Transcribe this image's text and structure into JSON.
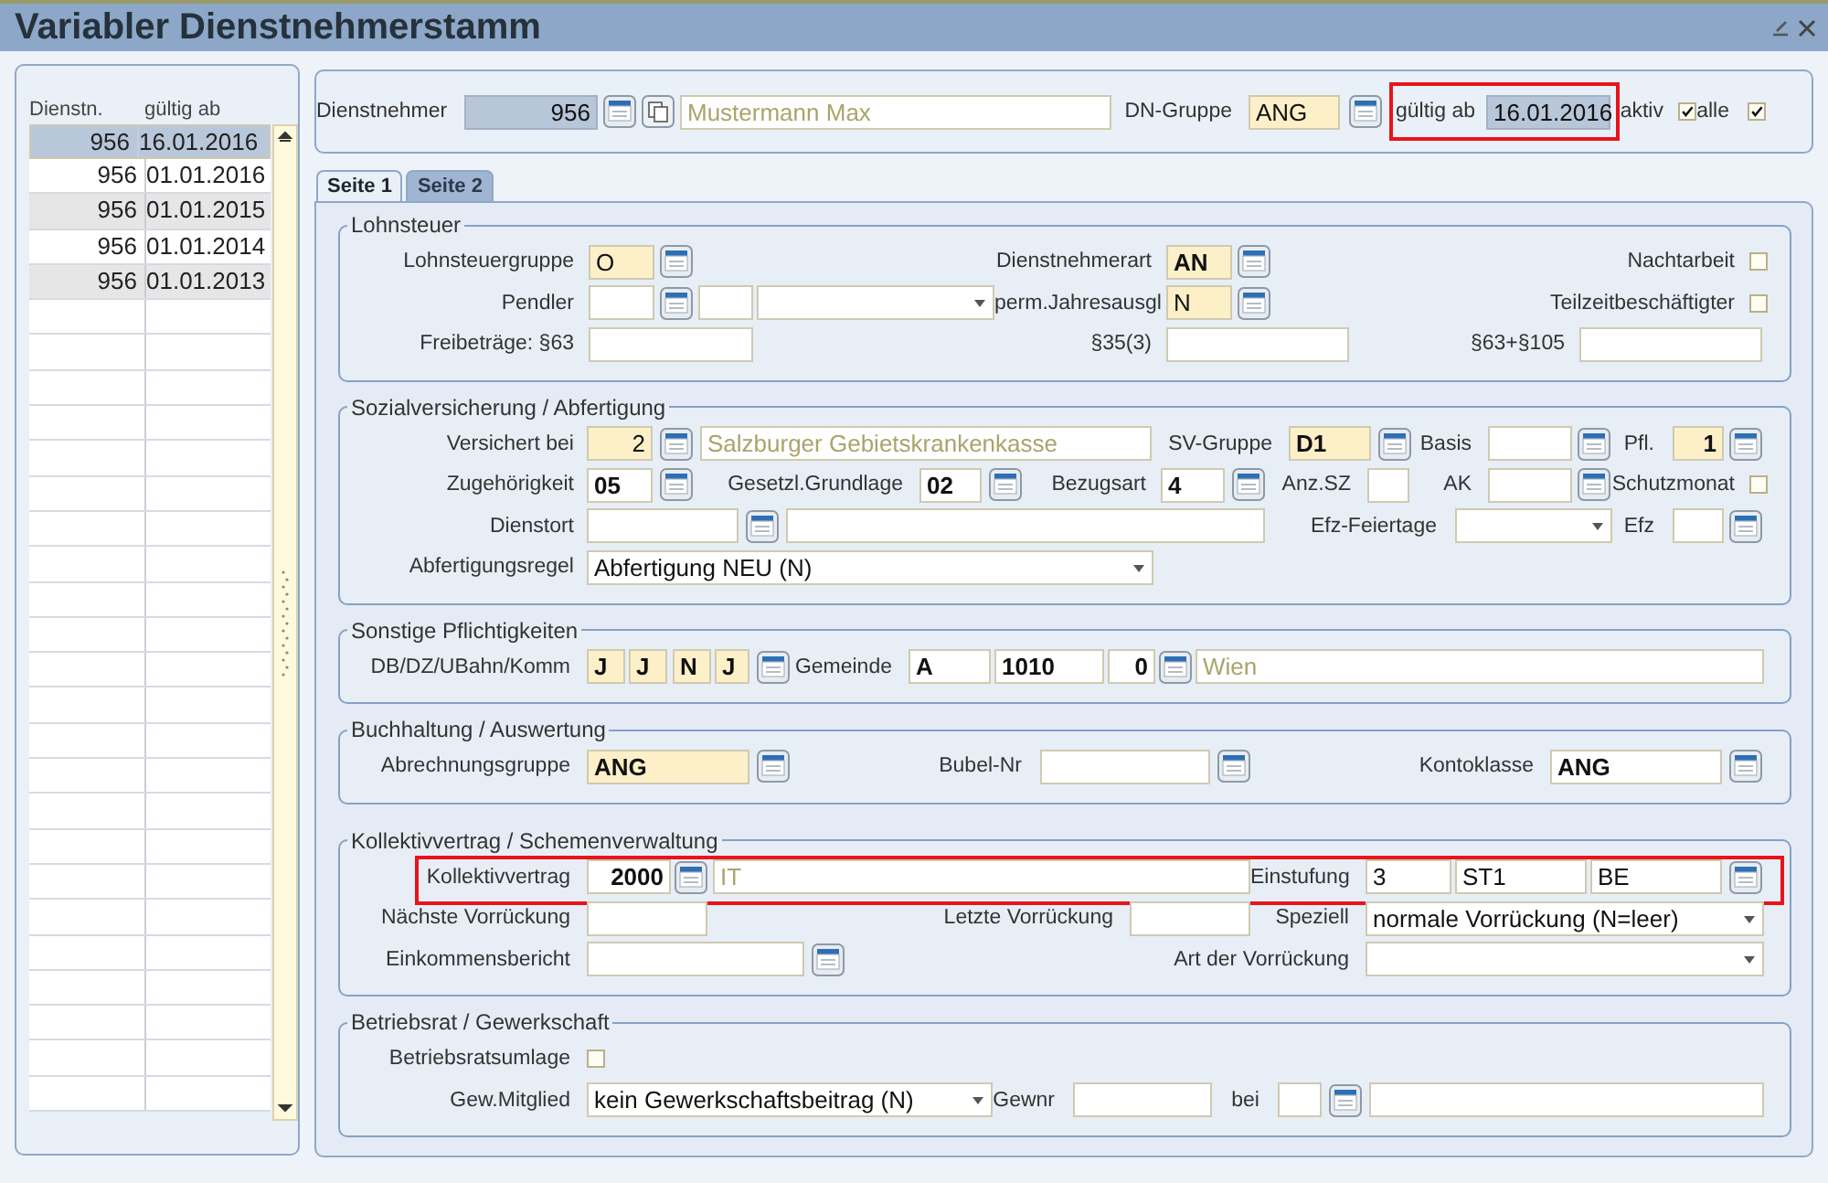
{
  "window": {
    "title": "Variabler Dienstnehmerstamm"
  },
  "list": {
    "columns": [
      "Dienstn.",
      "gültig ab"
    ],
    "rows": [
      {
        "cells": [
          "956",
          "16.01.2016"
        ],
        "selected": true
      },
      {
        "cells": [
          "956",
          "01.01.2016"
        ],
        "selected": false
      },
      {
        "cells": [
          "956",
          "01.01.2015"
        ],
        "selected": false
      },
      {
        "cells": [
          "956",
          "01.01.2014"
        ],
        "selected": false
      },
      {
        "cells": [
          "956",
          "01.01.2013"
        ],
        "selected": false
      }
    ]
  },
  "header": {
    "rows": [
      {
        "marked": true,
        "items": [
          {
            "kind": "label",
            "text": "Dienstnehmer"
          },
          {
            "kind": "readonly",
            "value": "956"
          },
          {
            "kind": "lookup"
          },
          {
            "kind": "copy"
          },
          {
            "kind": "display",
            "value": "Mustermann Max"
          },
          {
            "kind": "label",
            "text": "DN-Gruppe"
          },
          {
            "kind": "field",
            "value": "ANG",
            "highlighted": true,
            "bold": false
          },
          {
            "kind": "lookup"
          },
          {
            "kind": "label",
            "text": "gültig ab"
          },
          {
            "kind": "readonly",
            "value": "16.01.2016"
          },
          {
            "kind": "label",
            "text": "aktiv"
          },
          {
            "kind": "checkbox",
            "checked": true
          },
          {
            "kind": "label",
            "text": "alle"
          },
          {
            "kind": "checkbox",
            "checked": true
          }
        ]
      }
    ]
  },
  "tabs": [
    {
      "label": "Seite 1",
      "selected": true
    },
    {
      "label": "Seite 2",
      "selected": false
    }
  ],
  "sections": [
    {
      "title": "Lohnsteuer",
      "rows": [
        {
          "marked": false,
          "items": [
            {
              "kind": "label",
              "text": "Lohnsteuergruppe"
            },
            {
              "kind": "field",
              "value": "O",
              "highlighted": true,
              "bold": false
            },
            {
              "kind": "lookup"
            },
            {
              "kind": "label",
              "text": "Dienstnehmerart"
            },
            {
              "kind": "field",
              "value": "AN",
              "highlighted": true,
              "bold": true
            },
            {
              "kind": "lookup"
            },
            {
              "kind": "label",
              "text": "Nachtarbeit"
            },
            {
              "kind": "checkbox",
              "checked": false
            }
          ]
        },
        {
          "marked": false,
          "items": [
            {
              "kind": "label",
              "text": "Pendler"
            },
            {
              "kind": "field",
              "highlighted": false
            },
            {
              "kind": "lookup"
            },
            {
              "kind": "field",
              "highlighted": false
            },
            {
              "kind": "select"
            },
            {
              "kind": "label",
              "text": "perm.Jahresausgl"
            },
            {
              "kind": "field",
              "value": "N",
              "highlighted": true,
              "bold": false
            },
            {
              "kind": "lookup"
            },
            {
              "kind": "label",
              "text": "Teilzeitbeschäftigter"
            },
            {
              "kind": "checkbox",
              "checked": false
            }
          ]
        },
        {
          "marked": false,
          "items": [
            {
              "kind": "label",
              "text": "Freibeträge: §63"
            },
            {
              "kind": "field",
              "highlighted": false
            },
            {
              "kind": "label",
              "text": "§35(3)"
            },
            {
              "kind": "field",
              "highlighted": false
            },
            {
              "kind": "label",
              "text": "§63+§105"
            },
            {
              "kind": "field",
              "highlighted": false
            }
          ]
        }
      ]
    },
    {
      "title": "Sozialversicherung / Abfertigung",
      "rows": [
        {
          "marked": false,
          "items": [
            {
              "kind": "label",
              "text": "Versichert bei"
            },
            {
              "kind": "field",
              "value": "2",
              "highlighted": true,
              "bold": false
            },
            {
              "kind": "lookup"
            },
            {
              "kind": "display",
              "value": "Salzburger Gebietskrankenkasse"
            },
            {
              "kind": "label",
              "text": "SV-Gruppe"
            },
            {
              "kind": "field",
              "value": "D1",
              "highlighted": true,
              "bold": true
            },
            {
              "kind": "lookup"
            },
            {
              "kind": "label",
              "text": "Basis"
            },
            {
              "kind": "field",
              "highlighted": false
            },
            {
              "kind": "lookup"
            },
            {
              "kind": "label",
              "text": "Pfl."
            },
            {
              "kind": "field",
              "value": "1",
              "highlighted": true,
              "bold": true
            },
            {
              "kind": "lookup"
            }
          ]
        },
        {
          "marked": false,
          "items": [
            {
              "kind": "label",
              "text": "Zugehörigkeit"
            },
            {
              "kind": "field",
              "value": "05",
              "highlighted": false,
              "bold": true
            },
            {
              "kind": "lookup"
            },
            {
              "kind": "label",
              "text": "Gesetzl.Grundlage"
            },
            {
              "kind": "field",
              "value": "02",
              "highlighted": false,
              "bold": true
            },
            {
              "kind": "lookup"
            },
            {
              "kind": "label",
              "text": "Bezugsart"
            },
            {
              "kind": "field",
              "value": "4",
              "highlighted": false,
              "bold": true
            },
            {
              "kind": "lookup"
            },
            {
              "kind": "label",
              "text": "Anz.SZ"
            },
            {
              "kind": "field",
              "highlighted": false
            },
            {
              "kind": "label",
              "text": "AK"
            },
            {
              "kind": "field",
              "highlighted": false
            },
            {
              "kind": "lookup"
            },
            {
              "kind": "label",
              "text": "Schutzmonat"
            },
            {
              "kind": "checkbox",
              "checked": false
            }
          ]
        },
        {
          "marked": false,
          "items": [
            {
              "kind": "label",
              "text": "Dienstort"
            },
            {
              "kind": "field",
              "highlighted": false
            },
            {
              "kind": "lookup"
            },
            {
              "kind": "field",
              "highlighted": false
            },
            {
              "kind": "label",
              "text": "Efz-Feiertage"
            },
            {
              "kind": "select"
            },
            {
              "kind": "label",
              "text": "Efz"
            },
            {
              "kind": "field",
              "highlighted": false
            },
            {
              "kind": "lookup"
            }
          ]
        },
        {
          "marked": false,
          "items": [
            {
              "kind": "label",
              "text": "Abfertigungsregel"
            },
            {
              "kind": "select",
              "value": "Abfertigung NEU (N)"
            }
          ]
        }
      ]
    },
    {
      "title": "Sonstige Pflichtigkeiten",
      "rows": [
        {
          "marked": false,
          "items": [
            {
              "kind": "label",
              "text": "DB/DZ/UBahn/Komm"
            },
            {
              "kind": "field",
              "value": "J",
              "highlighted": true,
              "bold": true
            },
            {
              "kind": "field",
              "value": "J",
              "highlighted": true,
              "bold": true
            },
            {
              "kind": "field",
              "value": "N",
              "highlighted": true,
              "bold": true
            },
            {
              "kind": "field",
              "value": "J",
              "highlighted": true,
              "bold": true
            },
            {
              "kind": "lookup"
            },
            {
              "kind": "label",
              "text": "Gemeinde"
            },
            {
              "kind": "field",
              "value": "A",
              "highlighted": false,
              "bold": true
            },
            {
              "kind": "field",
              "value": "1010",
              "highlighted": false,
              "bold": true
            },
            {
              "kind": "field",
              "value": "0",
              "highlighted": false,
              "bold": true
            },
            {
              "kind": "lookup"
            },
            {
              "kind": "display",
              "value": "Wien"
            }
          ]
        }
      ]
    },
    {
      "title": "Buchhaltung / Auswertung",
      "rows": [
        {
          "marked": false,
          "items": [
            {
              "kind": "label",
              "text": "Abrechnungsgruppe"
            },
            {
              "kind": "field",
              "value": "ANG",
              "highlighted": true,
              "bold": true
            },
            {
              "kind": "lookup"
            },
            {
              "kind": "label",
              "text": "Bubel-Nr"
            },
            {
              "kind": "field",
              "highlighted": false
            },
            {
              "kind": "lookup"
            },
            {
              "kind": "label",
              "text": "Kontoklasse"
            },
            {
              "kind": "field",
              "value": "ANG",
              "highlighted": false,
              "bold": true
            },
            {
              "kind": "lookup"
            }
          ]
        }
      ]
    },
    {
      "title": "Kollektivvertrag / Schemenverwaltung",
      "rows": [
        {
          "marked": true,
          "items": [
            {
              "kind": "label",
              "text": "Kollektivvertrag"
            },
            {
              "kind": "field",
              "value": "2000",
              "highlighted": false,
              "bold": true
            },
            {
              "kind": "lookup"
            },
            {
              "kind": "display",
              "value": "IT"
            },
            {
              "kind": "label",
              "text": "Einstufung"
            },
            {
              "kind": "field",
              "value": "3",
              "highlighted": false,
              "bold": false
            },
            {
              "kind": "field",
              "value": "ST1",
              "highlighted": false,
              "bold": false
            },
            {
              "kind": "field",
              "value": "BE",
              "highlighted": false,
              "bold": false
            },
            {
              "kind": "lookup"
            }
          ]
        },
        {
          "marked": false,
          "items": [
            {
              "kind": "label",
              "text": "Nächste Vorrückung"
            },
            {
              "kind": "field",
              "highlighted": false
            },
            {
              "kind": "label",
              "text": "Letzte Vorrückung"
            },
            {
              "kind": "field",
              "highlighted": false
            },
            {
              "kind": "label",
              "text": "Speziell"
            },
            {
              "kind": "select",
              "value": "normale Vorrückung (N=leer)"
            }
          ]
        },
        {
          "marked": false,
          "items": [
            {
              "kind": "label",
              "text": "Einkommensbericht"
            },
            {
              "kind": "field",
              "highlighted": false
            },
            {
              "kind": "lookup"
            },
            {
              "kind": "label",
              "text": "Art der Vorrückung"
            },
            {
              "kind": "select"
            }
          ]
        }
      ]
    },
    {
      "title": "Betriebsrat / Gewerkschaft",
      "rows": [
        {
          "marked": false,
          "items": [
            {
              "kind": "label",
              "text": "Betriebsratsumlage"
            },
            {
              "kind": "checkbox",
              "checked": false
            }
          ]
        },
        {
          "marked": false,
          "items": [
            {
              "kind": "label",
              "text": "Gew.Mitglied"
            },
            {
              "kind": "select",
              "value": "kein Gewerkschaftsbeitrag (N)"
            },
            {
              "kind": "label",
              "text": "Gewnr"
            },
            {
              "kind": "field",
              "highlighted": false
            },
            {
              "kind": "label",
              "text": "bei"
            },
            {
              "kind": "field",
              "highlighted": false
            },
            {
              "kind": "lookup"
            },
            {
              "kind": "field",
              "highlighted": false
            }
          ]
        }
      ]
    }
  ]
}
